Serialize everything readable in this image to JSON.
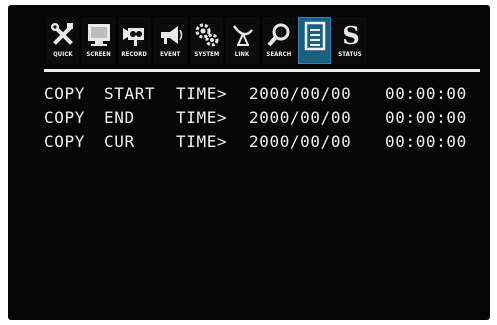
{
  "toolbar": {
    "items": [
      {
        "label": "QUICK",
        "icon": "quick-tools-icon"
      },
      {
        "label": "SCREEN",
        "icon": "monitor-icon"
      },
      {
        "label": "RECORD",
        "icon": "camera-icon"
      },
      {
        "label": "EVENT",
        "icon": "megaphone-icon"
      },
      {
        "label": "SYSTEM",
        "icon": "gears-icon"
      },
      {
        "label": "LINK",
        "icon": "satellite-icon"
      },
      {
        "label": "SEARCH",
        "icon": "magnifier-icon"
      },
      {
        "label": "",
        "icon": "document-icon",
        "active": true
      },
      {
        "label": "STATUS",
        "icon": "status-s-icon"
      }
    ],
    "active_color": "#1d5e83"
  },
  "rows": [
    {
      "w1": "COPY",
      "w2": "START",
      "w3": "TIME>",
      "date": "2000/00/00",
      "time": "00:00:00"
    },
    {
      "w1": "COPY",
      "w2": "END",
      "w3": "TIME>",
      "date": "2000/00/00",
      "time": "00:00:00"
    },
    {
      "w1": "COPY",
      "w2": "CUR",
      "w3": "TIME>",
      "date": "2000/00/00",
      "time": "00:00:00"
    }
  ]
}
